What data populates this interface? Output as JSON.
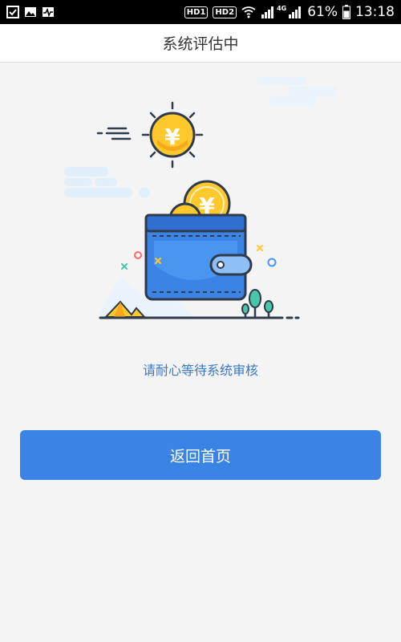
{
  "status_bar": {
    "hd1": "HD1",
    "hd2": "HD2",
    "net_4g": "4G",
    "battery": "61%",
    "time": "13:18",
    "left_icons": [
      "checklist-icon",
      "image-icon",
      "activity-icon"
    ],
    "right_icons": [
      "wifi-icon",
      "signal-icon",
      "signal-icon",
      "battery-icon"
    ]
  },
  "header": {
    "title": "系统评估中"
  },
  "illustration": {
    "icons": [
      "sun-coin-icon",
      "wallet-icon",
      "coin-icon",
      "cloud-icon",
      "mountain-icon",
      "tree-icon"
    ],
    "colors": {
      "wallet": "#3b83e4",
      "coin": "#ffc82c",
      "outline": "#2f3a4a"
    }
  },
  "main": {
    "message": "请耐心等待系统审核",
    "home_button_label": "返回首页"
  },
  "colors": {
    "accent": "#3b83e4",
    "message_text": "#3a78c9",
    "background": "#f4f4f4"
  }
}
